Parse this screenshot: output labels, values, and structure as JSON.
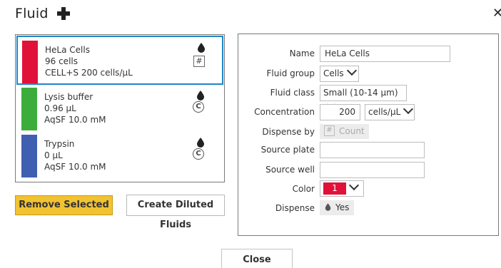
{
  "dialog": {
    "title": "Fluid",
    "add_icon": "plus-icon",
    "close_icon": "close-x-icon"
  },
  "fluids": [
    {
      "name": "HeLa Cells",
      "amount": "96 cells",
      "detail": "CELL+S  200 cells/µL",
      "color": "#e0123a",
      "marker": "#",
      "marker_type": "square",
      "selected": true
    },
    {
      "name": "Lysis buffer",
      "amount": "0.96 µL",
      "detail": "AqSF  10.0 mM",
      "color": "#3cad3a",
      "marker": "C",
      "marker_type": "circle",
      "selected": false
    },
    {
      "name": "Trypsin",
      "amount": "0 µL",
      "detail": "AqSF  10.0 mM",
      "color": "#3f5fb0",
      "marker": "C",
      "marker_type": "circle",
      "selected": false
    }
  ],
  "buttons": {
    "remove_selected": "Remove Selected",
    "create_diluted": "Create Diluted Fluids",
    "close": "Close"
  },
  "properties": {
    "name_label": "Name",
    "name_value": "HeLa Cells",
    "group_label": "Fluid group",
    "group_value": "Cells",
    "class_label": "Fluid class",
    "class_value": "Small (10-14 µm)",
    "concentration_label": "Concentration",
    "concentration_value": "200",
    "concentration_unit": "cells/µL",
    "dispense_by_label": "Dispense by",
    "dispense_by_value": "Count",
    "source_plate_label": "Source plate",
    "source_plate_value": "",
    "source_well_label": "Source well",
    "source_well_value": "",
    "color_label": "Color",
    "color_value": "1",
    "color_hex": "#e0123a",
    "dispense_label": "Dispense",
    "dispense_value": "Yes"
  },
  "colors": {
    "selection_border": "#1f86c8",
    "remove_button": "#f1c232"
  }
}
